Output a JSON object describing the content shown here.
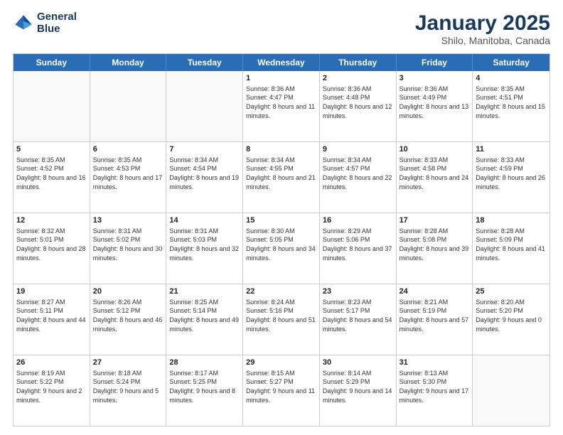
{
  "logo": {
    "line1": "General",
    "line2": "Blue"
  },
  "header": {
    "month": "January 2025",
    "location": "Shilo, Manitoba, Canada"
  },
  "weekdays": [
    "Sunday",
    "Monday",
    "Tuesday",
    "Wednesday",
    "Thursday",
    "Friday",
    "Saturday"
  ],
  "rows": [
    [
      {
        "day": "",
        "sunrise": "",
        "sunset": "",
        "daylight": ""
      },
      {
        "day": "",
        "sunrise": "",
        "sunset": "",
        "daylight": ""
      },
      {
        "day": "",
        "sunrise": "",
        "sunset": "",
        "daylight": ""
      },
      {
        "day": "1",
        "sunrise": "Sunrise: 8:36 AM",
        "sunset": "Sunset: 4:47 PM",
        "daylight": "Daylight: 8 hours and 11 minutes."
      },
      {
        "day": "2",
        "sunrise": "Sunrise: 8:36 AM",
        "sunset": "Sunset: 4:48 PM",
        "daylight": "Daylight: 8 hours and 12 minutes."
      },
      {
        "day": "3",
        "sunrise": "Sunrise: 8:36 AM",
        "sunset": "Sunset: 4:49 PM",
        "daylight": "Daylight: 8 hours and 13 minutes."
      },
      {
        "day": "4",
        "sunrise": "Sunrise: 8:35 AM",
        "sunset": "Sunset: 4:51 PM",
        "daylight": "Daylight: 8 hours and 15 minutes."
      }
    ],
    [
      {
        "day": "5",
        "sunrise": "Sunrise: 8:35 AM",
        "sunset": "Sunset: 4:52 PM",
        "daylight": "Daylight: 8 hours and 16 minutes."
      },
      {
        "day": "6",
        "sunrise": "Sunrise: 8:35 AM",
        "sunset": "Sunset: 4:53 PM",
        "daylight": "Daylight: 8 hours and 17 minutes."
      },
      {
        "day": "7",
        "sunrise": "Sunrise: 8:34 AM",
        "sunset": "Sunset: 4:54 PM",
        "daylight": "Daylight: 8 hours and 19 minutes."
      },
      {
        "day": "8",
        "sunrise": "Sunrise: 8:34 AM",
        "sunset": "Sunset: 4:55 PM",
        "daylight": "Daylight: 8 hours and 21 minutes."
      },
      {
        "day": "9",
        "sunrise": "Sunrise: 8:34 AM",
        "sunset": "Sunset: 4:57 PM",
        "daylight": "Daylight: 8 hours and 22 minutes."
      },
      {
        "day": "10",
        "sunrise": "Sunrise: 8:33 AM",
        "sunset": "Sunset: 4:58 PM",
        "daylight": "Daylight: 8 hours and 24 minutes."
      },
      {
        "day": "11",
        "sunrise": "Sunrise: 8:33 AM",
        "sunset": "Sunset: 4:59 PM",
        "daylight": "Daylight: 8 hours and 26 minutes."
      }
    ],
    [
      {
        "day": "12",
        "sunrise": "Sunrise: 8:32 AM",
        "sunset": "Sunset: 5:01 PM",
        "daylight": "Daylight: 8 hours and 28 minutes."
      },
      {
        "day": "13",
        "sunrise": "Sunrise: 8:31 AM",
        "sunset": "Sunset: 5:02 PM",
        "daylight": "Daylight: 8 hours and 30 minutes."
      },
      {
        "day": "14",
        "sunrise": "Sunrise: 8:31 AM",
        "sunset": "Sunset: 5:03 PM",
        "daylight": "Daylight: 8 hours and 32 minutes."
      },
      {
        "day": "15",
        "sunrise": "Sunrise: 8:30 AM",
        "sunset": "Sunset: 5:05 PM",
        "daylight": "Daylight: 8 hours and 34 minutes."
      },
      {
        "day": "16",
        "sunrise": "Sunrise: 8:29 AM",
        "sunset": "Sunset: 5:06 PM",
        "daylight": "Daylight: 8 hours and 37 minutes."
      },
      {
        "day": "17",
        "sunrise": "Sunrise: 8:28 AM",
        "sunset": "Sunset: 5:08 PM",
        "daylight": "Daylight: 8 hours and 39 minutes."
      },
      {
        "day": "18",
        "sunrise": "Sunrise: 8:28 AM",
        "sunset": "Sunset: 5:09 PM",
        "daylight": "Daylight: 8 hours and 41 minutes."
      }
    ],
    [
      {
        "day": "19",
        "sunrise": "Sunrise: 8:27 AM",
        "sunset": "Sunset: 5:11 PM",
        "daylight": "Daylight: 8 hours and 44 minutes."
      },
      {
        "day": "20",
        "sunrise": "Sunrise: 8:26 AM",
        "sunset": "Sunset: 5:12 PM",
        "daylight": "Daylight: 8 hours and 46 minutes."
      },
      {
        "day": "21",
        "sunrise": "Sunrise: 8:25 AM",
        "sunset": "Sunset: 5:14 PM",
        "daylight": "Daylight: 8 hours and 49 minutes."
      },
      {
        "day": "22",
        "sunrise": "Sunrise: 8:24 AM",
        "sunset": "Sunset: 5:16 PM",
        "daylight": "Daylight: 8 hours and 51 minutes."
      },
      {
        "day": "23",
        "sunrise": "Sunrise: 8:23 AM",
        "sunset": "Sunset: 5:17 PM",
        "daylight": "Daylight: 8 hours and 54 minutes."
      },
      {
        "day": "24",
        "sunrise": "Sunrise: 8:21 AM",
        "sunset": "Sunset: 5:19 PM",
        "daylight": "Daylight: 8 hours and 57 minutes."
      },
      {
        "day": "25",
        "sunrise": "Sunrise: 8:20 AM",
        "sunset": "Sunset: 5:20 PM",
        "daylight": "Daylight: 9 hours and 0 minutes."
      }
    ],
    [
      {
        "day": "26",
        "sunrise": "Sunrise: 8:19 AM",
        "sunset": "Sunset: 5:22 PM",
        "daylight": "Daylight: 9 hours and 2 minutes."
      },
      {
        "day": "27",
        "sunrise": "Sunrise: 8:18 AM",
        "sunset": "Sunset: 5:24 PM",
        "daylight": "Daylight: 9 hours and 5 minutes."
      },
      {
        "day": "28",
        "sunrise": "Sunrise: 8:17 AM",
        "sunset": "Sunset: 5:25 PM",
        "daylight": "Daylight: 9 hours and 8 minutes."
      },
      {
        "day": "29",
        "sunrise": "Sunrise: 8:15 AM",
        "sunset": "Sunset: 5:27 PM",
        "daylight": "Daylight: 9 hours and 11 minutes."
      },
      {
        "day": "30",
        "sunrise": "Sunrise: 8:14 AM",
        "sunset": "Sunset: 5:29 PM",
        "daylight": "Daylight: 9 hours and 14 minutes."
      },
      {
        "day": "31",
        "sunrise": "Sunrise: 8:13 AM",
        "sunset": "Sunset: 5:30 PM",
        "daylight": "Daylight: 9 hours and 17 minutes."
      },
      {
        "day": "",
        "sunrise": "",
        "sunset": "",
        "daylight": ""
      }
    ]
  ]
}
